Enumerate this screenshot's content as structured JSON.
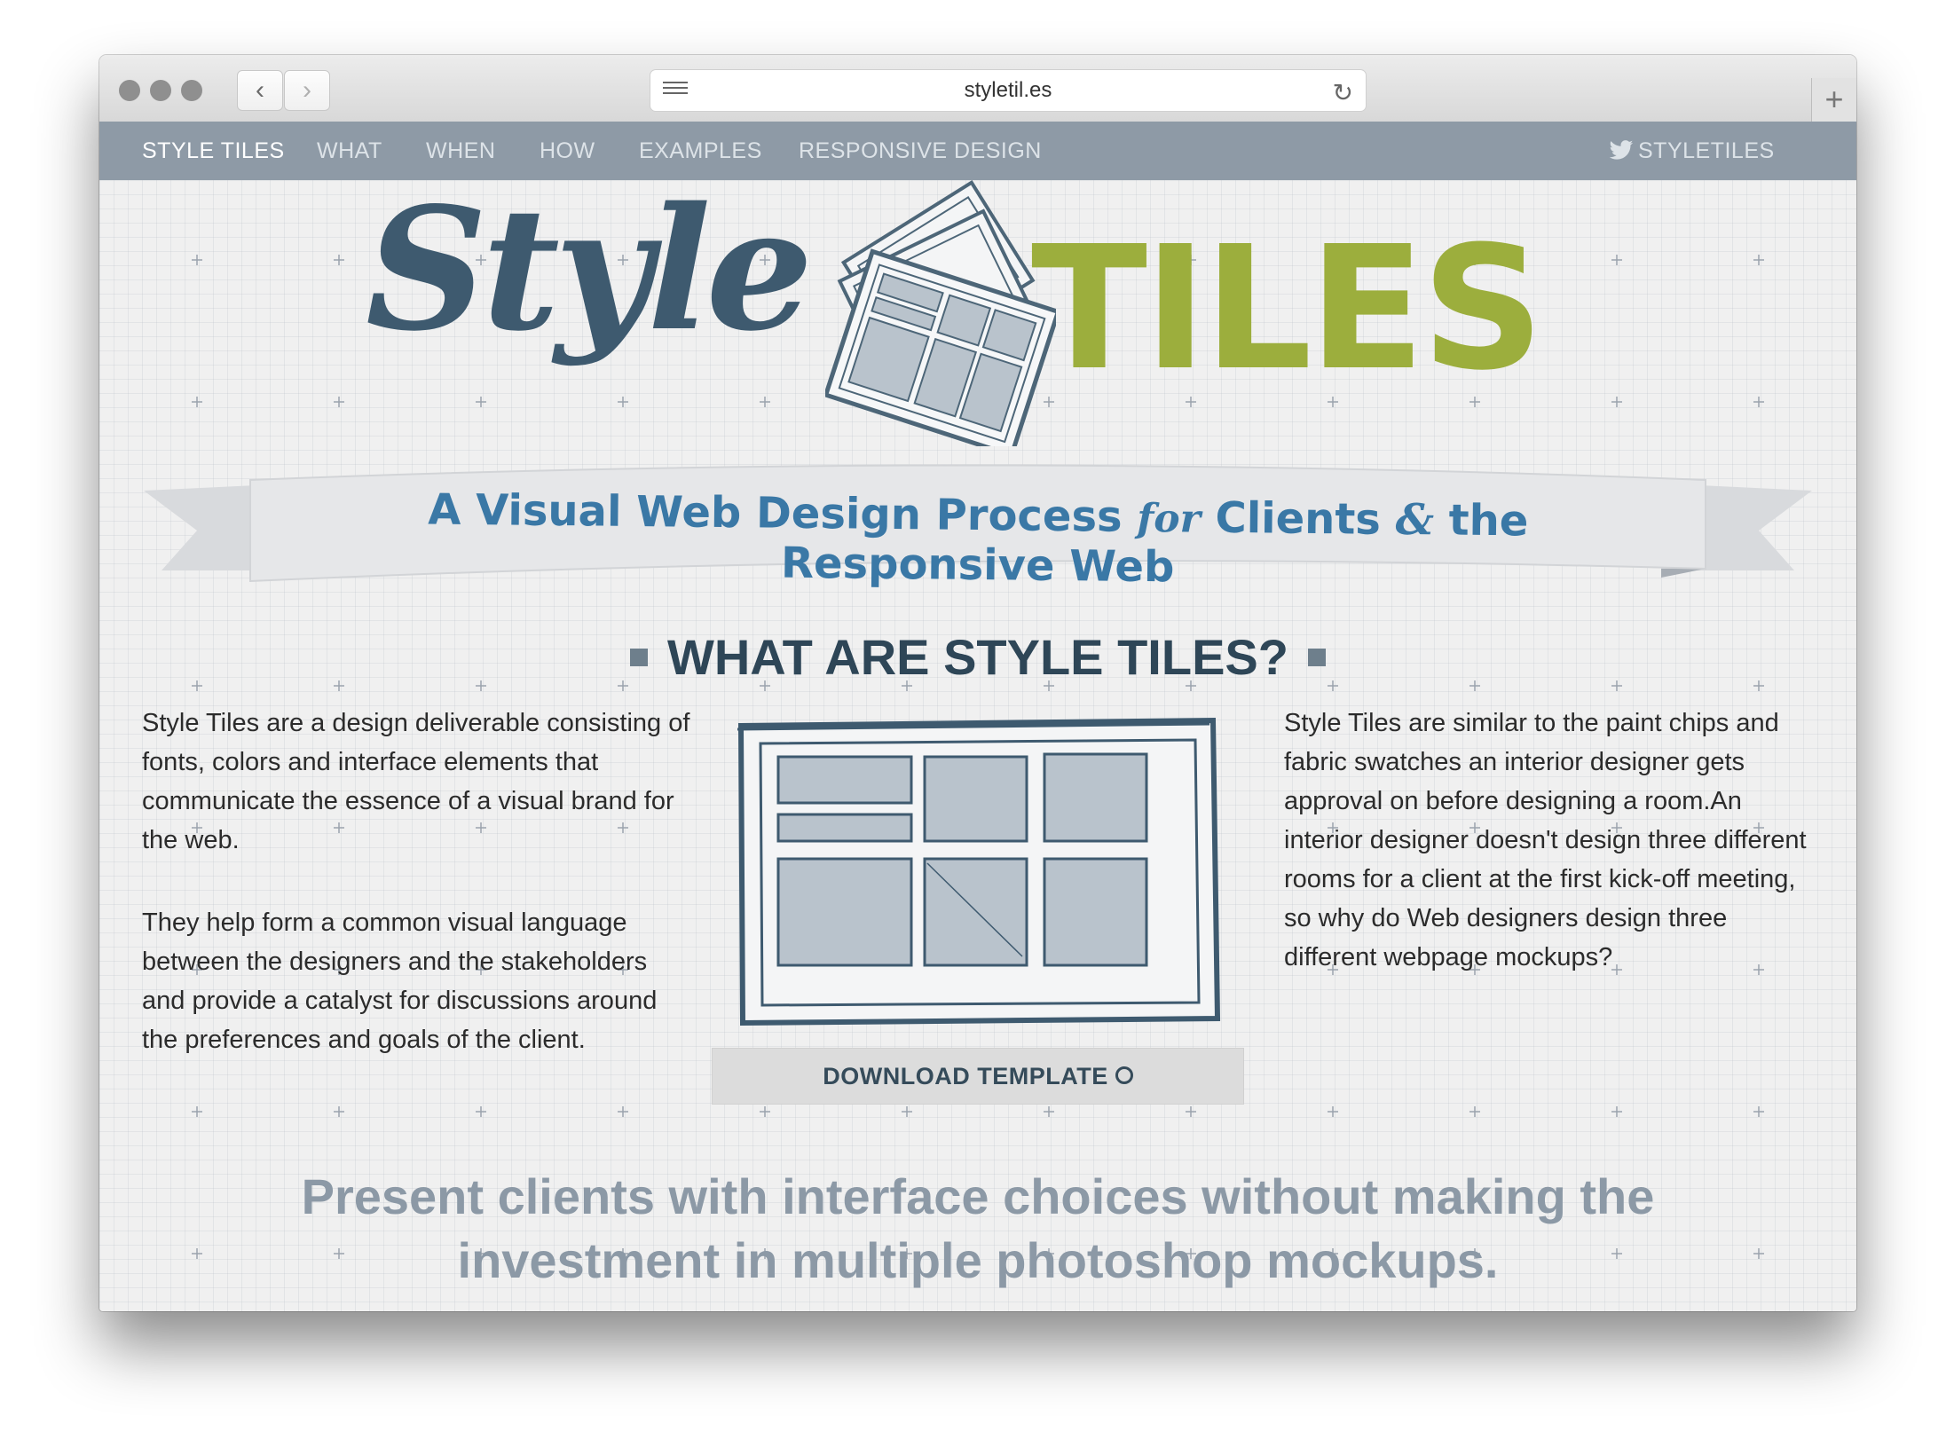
{
  "browser": {
    "url": "styletil.es",
    "back_icon": "chevron-left-icon",
    "forward_icon": "chevron-right-icon",
    "reader_icon": "reader-icon",
    "reload_icon": "reload-icon",
    "new_tab_icon": "plus-icon"
  },
  "nav": {
    "items": [
      "STYLE TILES",
      "WHAT",
      "WHEN",
      "HOW",
      "EXAMPLES",
      "RESPONSIVE DESIGN"
    ],
    "active": "STYLE TILES",
    "twitter_label": "STYLETILES",
    "twitter_icon": "twitter-bird-icon"
  },
  "logo": {
    "style_word": "Style",
    "tiles_word": "TILES"
  },
  "tagline": {
    "part1": "A Visual Web Design Process",
    "for_word": "for",
    "part2": "Clients",
    "amp": "&",
    "part3": "the Responsive Web"
  },
  "section": {
    "title": "WHAT ARE STYLE TILES?",
    "left_p1": "Style Tiles are a design deliverable consisting of fonts, colors and interface elements that communicate the essence of a visual brand for the web.",
    "left_p2": "They help form a common visual language between the designers and the stakeholders and provide a catalyst for discussions around the preferences and goals of the client.",
    "right_p1": "Style Tiles are similar to the paint chips and fabric swatches an interior designer gets approval on before designing a room.An interior designer doesn't design three different rooms for a client at the first kick-off meeting, so why do Web designers design three different webpage mockups?",
    "download_label": "DOWNLOAD TEMPLATE",
    "download_icon": "download-circle-icon"
  },
  "pitch": {
    "line1": "Present clients with interface choices without making the",
    "line2": "investment in multiple photoshop mockups."
  },
  "colors": {
    "nav_bg": "#8e9aa6",
    "logo_blue": "#3e5a6f",
    "logo_green": "#9cae3d",
    "tagline_blue": "#3a78a6",
    "pitch_gray": "#8c99a6"
  }
}
